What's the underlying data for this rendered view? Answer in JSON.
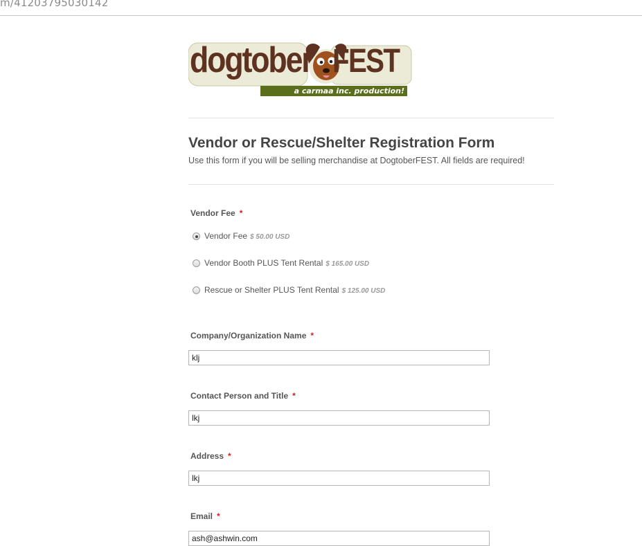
{
  "browser": {
    "url": "m/41203795030142"
  },
  "logo": {
    "word_dog": "dogtober",
    "word_fest": "FEST",
    "tagline": "a carmaa inc. production!",
    "colors": {
      "brown": "#5e3220",
      "dog": "#8b4513",
      "green": "#5a6e1c"
    }
  },
  "form": {
    "title": "Vendor or Rescue/Shelter Registration Form",
    "subtitle": "Use this form if you will be selling merchandise at DogtoberFEST. All fields are required!",
    "required_marker": "*",
    "vendor_fee": {
      "label": "Vendor Fee",
      "options": [
        {
          "label": "Vendor Fee",
          "price": "$ 50.00 USD",
          "checked": true
        },
        {
          "label": "Vendor Booth PLUS Tent Rental",
          "price": "$ 165.00 USD",
          "checked": false
        },
        {
          "label": "Rescue or Shelter PLUS Tent Rental",
          "price": "$ 125.00 USD",
          "checked": false
        }
      ]
    },
    "fields": [
      {
        "label": "Company/Organization Name",
        "value": "klj"
      },
      {
        "label": "Contact Person and Title",
        "value": "lkj"
      },
      {
        "label": "Address",
        "value": "lkj"
      },
      {
        "label": "Email",
        "value": "ash@ashwin.com"
      }
    ]
  }
}
